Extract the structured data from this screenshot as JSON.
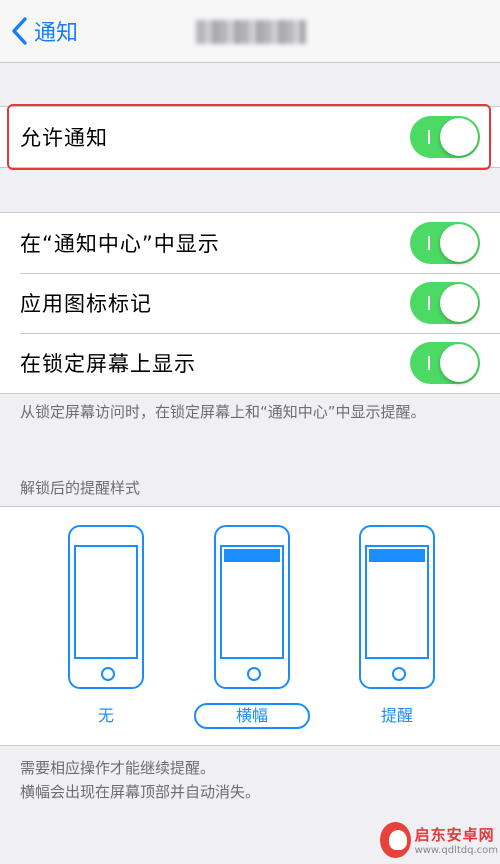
{
  "nav": {
    "back_label": "通知",
    "title": "██████"
  },
  "allow": {
    "label": "允许通知",
    "on": true
  },
  "settings": [
    {
      "label": "在“通知中心”中显示",
      "on": true
    },
    {
      "label": "应用图标标记",
      "on": true
    },
    {
      "label": "在锁定屏幕上显示",
      "on": true
    }
  ],
  "lock_footnote": "从锁定屏幕访问时，在锁定屏幕上和“通知中心”中显示提醒。",
  "alert_style": {
    "header": "解锁后的提醒样式",
    "options": [
      {
        "label": "无"
      },
      {
        "label": "横幅",
        "selected": true
      },
      {
        "label": "提醒"
      }
    ],
    "footnote_line1": "需要相应操作才能继续提醒。",
    "footnote_line2": "横幅会出现在屏幕顶部并自动消失。"
  },
  "watermark": {
    "name": "启东安卓网",
    "url": "www.qdltdq.com"
  },
  "colors": {
    "accent": "#157efb",
    "toggle_on": "#4cd964",
    "highlight": "#e23a3a"
  }
}
